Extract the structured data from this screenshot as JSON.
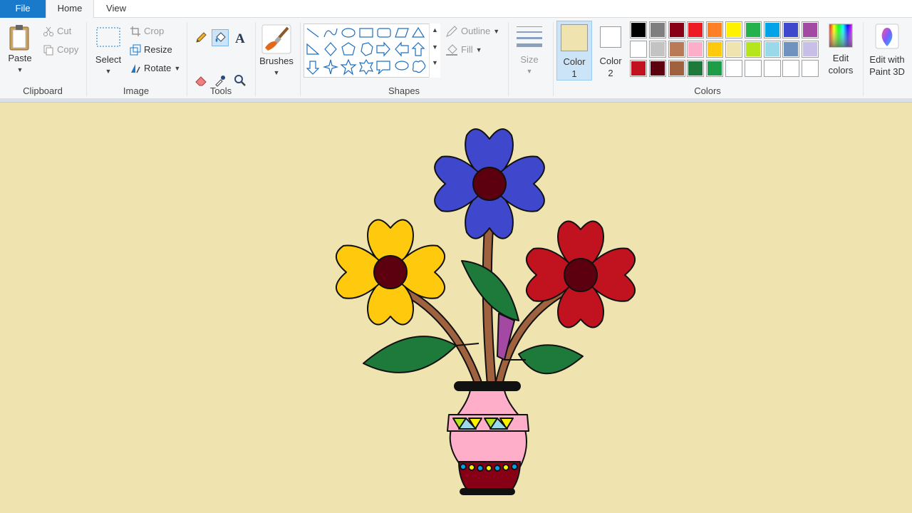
{
  "tabs": {
    "file": "File",
    "home": "Home",
    "view": "View"
  },
  "clipboard": {
    "paste": "Paste",
    "cut": "Cut",
    "copy": "Copy",
    "group": "Clipboard"
  },
  "image": {
    "select": "Select",
    "crop": "Crop",
    "resize": "Resize",
    "rotate": "Rotate",
    "group": "Image"
  },
  "tools": {
    "group": "Tools"
  },
  "brushes": {
    "label": "Brushes"
  },
  "shapes": {
    "outline": "Outline",
    "fill": "Fill",
    "group": "Shapes"
  },
  "size": {
    "label": "Size"
  },
  "colors": {
    "color1_label": "Color",
    "color1_num": "1",
    "color2_label": "Color",
    "color2_num": "2",
    "edit_colors_1": "Edit",
    "edit_colors_2": "colors",
    "paint3d_1": "Edit with",
    "paint3d_2": "Paint 3D",
    "group": "Colors",
    "color1_value": "#efe3b0",
    "color2_value": "#ffffff",
    "palette_row1": [
      "#000000",
      "#7f7f7f",
      "#880015",
      "#ed1c24",
      "#ff7f27",
      "#fff200",
      "#22b14c",
      "#00a2e8",
      "#3f48cc",
      "#a349a4"
    ],
    "palette_row2": [
      "#ffffff",
      "#c3c3c3",
      "#b97a57",
      "#ffaec9",
      "#ffc90e",
      "#efe4b0",
      "#b5e61d",
      "#99d9ea",
      "#7092be",
      "#c8bfe7"
    ],
    "palette_row3": [
      "#c1121f",
      "#5c0010",
      "#a0613f",
      "#1d7a3a",
      "#1e9c47",
      "#ffffff",
      "#ffffff",
      "#ffffff",
      "#ffffff",
      "#ffffff"
    ]
  }
}
